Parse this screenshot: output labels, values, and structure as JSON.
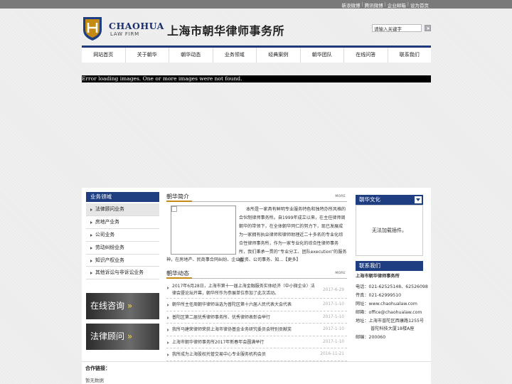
{
  "top_links": [
    "新浪微博",
    "腾讯微博",
    "企业邮箱",
    "设为首页"
  ],
  "brand": {
    "en": "CHAOHUA",
    "sub": "LAW FIRM",
    "cn": "上海市朝华律师事务所"
  },
  "search": {
    "value": "请输入关键字"
  },
  "nav": [
    "网站首页",
    "关于朝华",
    "朝华动态",
    "业务领域",
    "经典案例",
    "朝华团队",
    "在线问答",
    "联系我们"
  ],
  "error_message": "Error loading images. One or more images were not found.",
  "left": {
    "title": "业务领域",
    "items": [
      "法律顾问业务",
      "房地产业务",
      "公司业务",
      "劳动纠纷业务",
      "知识产权业务",
      "其他诉讼与非诉讼业务"
    ],
    "banner1": {
      "a": "在线咨询",
      "b": "»"
    },
    "banner2": {
      "a": "法律顾问",
      "b": "»"
    }
  },
  "intro": {
    "title": "朝华简介",
    "more": "MORE",
    "text": "本所是一家具有鲜明专业服务特色和独特办所风格的合伙制律师事务所。自1999年成立以来，在主任律师周朝华的带领下，在全体朝华同仁的努力下，现已发展成为一家拥有执业律师和律师助理近二十多名的专业化综合性律师事务所，作为一家专业化的综合性律师事务所，我们秉承一贯的“专业分工、团队execution”的服务精",
    "tail": "神，在房地产、民商事合同纠纷、企业投资、公司事务、知...【更多】"
  },
  "news": {
    "title": "朝华动态",
    "more": "MORE",
    "items": [
      {
        "title": "2017年6月28日，上海市第十一届上海金融服务实体经济（中小微企业）法律会暨论坛开幕，朝华所作为参展单位参加了此次活动。",
        "date": "2017-6-29"
      },
      {
        "title": "朝华所主任周朝华律师当选为普陀区第十六届人民代表大会代表",
        "date": "2017-1-10"
      },
      {
        "title": "普陀区第二届优秀律师事务所、优秀律师表彰会举行",
        "date": "2017-1-10"
      },
      {
        "title": "我所马建荣律师荣获上海市律协基金业务研究委员会特别贡献奖",
        "date": "2017-1-10"
      },
      {
        "title": "上海市朝华律师事务所2017年新春年会圆满举行",
        "date": "2017-1-10"
      },
      {
        "title": "我所成为上海股权托管交易中心专业服务机构会员",
        "date": "2016-11-21"
      }
    ]
  },
  "culture": {
    "title": "朝华文化",
    "message": "无法加载插件。"
  },
  "contact": {
    "title": "联系我们",
    "name": "上海市朝华律师事务所",
    "lines": [
      "电话：021-62525148、62526098",
      "传真：021-62999510",
      "网址：www.chaohualaw.com",
      "邮箱：office@chaohualaw.com",
      "地址：上海市普陀区西康路1255号",
      "普陀科技大厦18楼A座",
      "邮编：200060"
    ]
  },
  "footer": {
    "title": "合作链接：",
    "text": "暂无数据"
  },
  "colors": {
    "navy": "#1f3e82",
    "gold": "#c58a14",
    "topbar": "#7a7a7a"
  }
}
